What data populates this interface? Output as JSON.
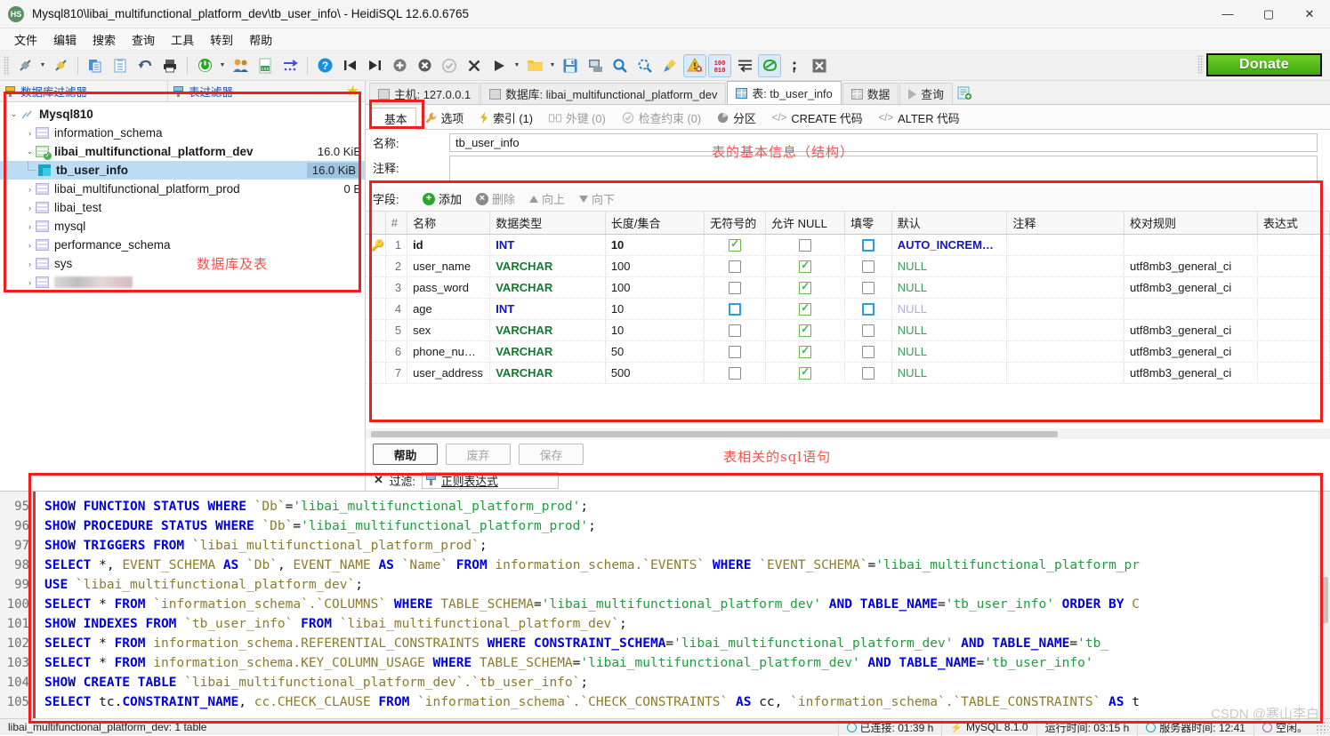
{
  "window": {
    "title": "Mysql810\\libai_multifunctional_platform_dev\\tb_user_info\\ - HeidiSQL 12.6.0.6765",
    "logo_text": "HS",
    "minimize": "—",
    "maximize": "▢",
    "close": "✕"
  },
  "menu": {
    "items": [
      "文件",
      "编辑",
      "搜索",
      "查询",
      "工具",
      "转到",
      "帮助"
    ]
  },
  "toolbar": {
    "donate_label": "Donate",
    "icons": [
      "connect-icon",
      "connect-dropdown",
      "disconnect-icon",
      "copy-icon",
      "paste-icon",
      "undo-icon",
      "print-icon",
      "refresh-icon",
      "refresh-dropdown",
      "users-icon",
      "csv-import-icon",
      "bulk-table-editor-icon",
      "help-icon",
      "first-icon",
      "last-icon",
      "add-icon",
      "remove-icon",
      "commit-icon",
      "rollback-icon",
      "run-icon",
      "run-dropdown",
      "open-icon",
      "open-dropdown",
      "save-icon",
      "save-as-icon",
      "find-icon",
      "find-replace-icon",
      "clean-icon",
      "error-icon",
      "binary-icon",
      "wrap-icon",
      "sql-format-icon",
      "semicolon-icon",
      "stop-icon"
    ]
  },
  "filters": {
    "database_filter": "数据库过滤器",
    "table_filter": "表过滤器",
    "star": "★"
  },
  "tree": {
    "root": {
      "label": "Mysql810",
      "expanded": true
    },
    "items": [
      {
        "label": "information_schema",
        "size": "",
        "level": 2,
        "expanded": false,
        "selected": false,
        "bold": false,
        "icon": "database-icon"
      },
      {
        "label": "libai_multifunctional_platform_dev",
        "size": "16.0 KiB",
        "level": 2,
        "expanded": true,
        "selected": false,
        "bold": true,
        "icon": "database-active-icon"
      },
      {
        "label": "tb_user_info",
        "size": "16.0 KiB",
        "level": 3,
        "expanded": null,
        "selected": true,
        "bold": true,
        "icon": "table-icon"
      },
      {
        "label": "libai_multifunctional_platform_prod",
        "size": "0 B",
        "level": 2,
        "expanded": false,
        "selected": false,
        "bold": false,
        "icon": "database-icon"
      },
      {
        "label": "libai_test",
        "size": "",
        "level": 2,
        "expanded": false,
        "selected": false,
        "bold": false,
        "icon": "database-icon"
      },
      {
        "label": "mysql",
        "size": "",
        "level": 2,
        "expanded": false,
        "selected": false,
        "bold": false,
        "icon": "database-icon"
      },
      {
        "label": "performance_schema",
        "size": "",
        "level": 2,
        "expanded": false,
        "selected": false,
        "bold": false,
        "icon": "database-icon"
      },
      {
        "label": "sys",
        "size": "",
        "level": 2,
        "expanded": false,
        "selected": false,
        "bold": false,
        "icon": "database-icon"
      },
      {
        "label": "",
        "size": "",
        "level": 2,
        "expanded": false,
        "selected": false,
        "bold": false,
        "icon": "database-icon",
        "redacted": true
      }
    ]
  },
  "main_tabs": [
    {
      "label": "主机: 127.0.0.1",
      "icon": "host-icon",
      "active": false
    },
    {
      "label": "数据库: libai_multifunctional_platform_dev",
      "icon": "database-icon",
      "active": false
    },
    {
      "label": "表: tb_user_info",
      "icon": "table-icon",
      "active": true
    },
    {
      "label": "数据",
      "icon": "data-grid-icon",
      "active": false
    },
    {
      "label": "查询",
      "icon": "query-play-icon",
      "active": false
    }
  ],
  "new_query_tab_icon": "new-query-tab-icon",
  "sub_tabs": [
    {
      "label": "基本",
      "icon": "basic-table-icon",
      "active": true
    },
    {
      "label": "选项",
      "icon": "wrench-icon",
      "active": false
    },
    {
      "label": "索引 (1)",
      "icon": "lightning-icon",
      "active": false
    },
    {
      "label": "外键 (0)",
      "icon": "foreign-key-icon",
      "active": false
    },
    {
      "label": "检查约束 (0)",
      "icon": "check-icon",
      "active": false
    },
    {
      "label": "分区",
      "icon": "partition-icon",
      "active": false
    },
    {
      "label": "CREATE 代码",
      "icon": "code-icon",
      "active": false
    },
    {
      "label": "ALTER 代码",
      "icon": "code-icon",
      "active": false
    }
  ],
  "table_info": {
    "name_label": "名称:",
    "name_value": "tb_user_info",
    "comment_label": "注释:",
    "comment_value": ""
  },
  "grid_toolbar": {
    "fields_label": "字段:",
    "add": "添加",
    "remove": "删除",
    "move_up": "向上",
    "move_down": "向下"
  },
  "columns_grid": {
    "headers": [
      "#",
      "名称",
      "数据类型",
      "长度/集合",
      "无符号的",
      "允许 NULL",
      "填零",
      "默认",
      "注释",
      "校对规则",
      "表达式"
    ],
    "rows": [
      {
        "num": "1",
        "key": true,
        "name": "id",
        "type": "INT",
        "type_kind": "int",
        "length": "10",
        "unsigned": true,
        "allow_null": false,
        "zerofill": false,
        "zerofill_hl": true,
        "default": "AUTO_INCREME…",
        "default_kind": "autoinc",
        "comment": "",
        "collation": "",
        "expression": "",
        "bold": true
      },
      {
        "num": "2",
        "key": false,
        "name": "user_name",
        "type": "VARCHAR",
        "type_kind": "text",
        "length": "100",
        "unsigned": false,
        "allow_null": true,
        "zerofill": false,
        "zerofill_hl": false,
        "default": "NULL",
        "default_kind": "null",
        "comment": "",
        "collation": "utf8mb3_general_ci",
        "expression": "",
        "bold": false
      },
      {
        "num": "3",
        "key": false,
        "name": "pass_word",
        "type": "VARCHAR",
        "type_kind": "text",
        "length": "100",
        "unsigned": false,
        "allow_null": true,
        "zerofill": false,
        "zerofill_hl": false,
        "default": "NULL",
        "default_kind": "null",
        "comment": "",
        "collation": "utf8mb3_general_ci",
        "expression": "",
        "bold": false
      },
      {
        "num": "4",
        "key": false,
        "name": "age",
        "type": "INT",
        "type_kind": "int",
        "length": "10",
        "unsigned": false,
        "unsigned_hl": true,
        "allow_null": true,
        "zerofill": false,
        "zerofill_hl": true,
        "default": "NULL",
        "default_kind": "null-faint",
        "comment": "",
        "collation": "",
        "expression": "",
        "bold": false
      },
      {
        "num": "5",
        "key": false,
        "name": "sex",
        "type": "VARCHAR",
        "type_kind": "text",
        "length": "10",
        "unsigned": false,
        "allow_null": true,
        "zerofill": false,
        "zerofill_hl": false,
        "default": "NULL",
        "default_kind": "null",
        "comment": "",
        "collation": "utf8mb3_general_ci",
        "expression": "",
        "bold": false
      },
      {
        "num": "6",
        "key": false,
        "name": "phone_numb…",
        "type": "VARCHAR",
        "type_kind": "text",
        "length": "50",
        "unsigned": false,
        "allow_null": true,
        "zerofill": false,
        "zerofill_hl": false,
        "default": "NULL",
        "default_kind": "null",
        "comment": "",
        "collation": "utf8mb3_general_ci",
        "expression": "",
        "bold": false
      },
      {
        "num": "7",
        "key": false,
        "name": "user_address",
        "type": "VARCHAR",
        "type_kind": "text",
        "length": "500",
        "unsigned": false,
        "allow_null": true,
        "zerofill": false,
        "zerofill_hl": false,
        "default": "NULL",
        "default_kind": "null",
        "comment": "",
        "collation": "utf8mb3_general_ci",
        "expression": "",
        "bold": false
      }
    ]
  },
  "action_buttons": {
    "help": "帮助",
    "discard": "废弃",
    "save": "保存"
  },
  "low_filter": {
    "close": "✕",
    "label": "过滤:",
    "regex": "正则表达式"
  },
  "sql_log": {
    "line_numbers": [
      "95",
      "96",
      "97",
      "98",
      "99",
      "100",
      "101",
      "102",
      "103",
      "104",
      "105"
    ],
    "lines": [
      [
        {
          "t": "SHOW FUNCTION STATUS WHERE ",
          "c": "kw"
        },
        {
          "t": "`Db`",
          "c": "bt"
        },
        {
          "t": "=",
          "c": "pl"
        },
        {
          "t": "'libai_multifunctional_platform_prod'",
          "c": "str"
        },
        {
          "t": ";",
          "c": "pl"
        }
      ],
      [
        {
          "t": "SHOW PROCEDURE STATUS WHERE ",
          "c": "kw"
        },
        {
          "t": "`Db`",
          "c": "bt"
        },
        {
          "t": "=",
          "c": "pl"
        },
        {
          "t": "'libai_multifunctional_platform_prod'",
          "c": "str"
        },
        {
          "t": ";",
          "c": "pl"
        }
      ],
      [
        {
          "t": "SHOW TRIGGERS FROM ",
          "c": "kw"
        },
        {
          "t": "`libai_multifunctional_platform_prod`",
          "c": "bt"
        },
        {
          "t": ";",
          "c": "pl"
        }
      ],
      [
        {
          "t": "SELECT ",
          "c": "kw"
        },
        {
          "t": "*, ",
          "c": "pl"
        },
        {
          "t": "EVENT_SCHEMA ",
          "c": "bt"
        },
        {
          "t": "AS ",
          "c": "kw"
        },
        {
          "t": "`Db`",
          "c": "bt"
        },
        {
          "t": ", ",
          "c": "pl"
        },
        {
          "t": "EVENT_NAME ",
          "c": "bt"
        },
        {
          "t": "AS ",
          "c": "kw"
        },
        {
          "t": "`Name` ",
          "c": "bt"
        },
        {
          "t": "FROM ",
          "c": "kw"
        },
        {
          "t": "information_schema.`EVENTS` ",
          "c": "bt"
        },
        {
          "t": "WHERE ",
          "c": "kw"
        },
        {
          "t": "`EVENT_SCHEMA`",
          "c": "bt"
        },
        {
          "t": "=",
          "c": "pl"
        },
        {
          "t": "'libai_multifunctional_platform_pr",
          "c": "str"
        }
      ],
      [
        {
          "t": "USE ",
          "c": "kw"
        },
        {
          "t": "`libai_multifunctional_platform_dev`",
          "c": "bt"
        },
        {
          "t": ";",
          "c": "pl"
        }
      ],
      [
        {
          "t": "SELECT ",
          "c": "kw"
        },
        {
          "t": "* ",
          "c": "pl"
        },
        {
          "t": "FROM ",
          "c": "kw"
        },
        {
          "t": "`information_schema`.`COLUMNS` ",
          "c": "bt"
        },
        {
          "t": "WHERE ",
          "c": "kw"
        },
        {
          "t": "TABLE_SCHEMA",
          "c": "bt"
        },
        {
          "t": "=",
          "c": "pl"
        },
        {
          "t": "'libai_multifunctional_platform_dev' ",
          "c": "str"
        },
        {
          "t": "AND TABLE_NAME",
          "c": "kw"
        },
        {
          "t": "=",
          "c": "pl"
        },
        {
          "t": "'tb_user_info' ",
          "c": "str"
        },
        {
          "t": "ORDER BY ",
          "c": "kw"
        },
        {
          "t": "C",
          "c": "bt"
        }
      ],
      [
        {
          "t": "SHOW INDEXES FROM ",
          "c": "kw"
        },
        {
          "t": "`tb_user_info` ",
          "c": "bt"
        },
        {
          "t": "FROM ",
          "c": "kw"
        },
        {
          "t": "`libai_multifunctional_platform_dev`",
          "c": "bt"
        },
        {
          "t": ";",
          "c": "pl"
        }
      ],
      [
        {
          "t": "SELECT ",
          "c": "kw"
        },
        {
          "t": "* ",
          "c": "pl"
        },
        {
          "t": "FROM ",
          "c": "kw"
        },
        {
          "t": "information_schema.REFERENTIAL_CONSTRAINTS ",
          "c": "bt"
        },
        {
          "t": "WHERE   CONSTRAINT_SCHEMA",
          "c": "kw"
        },
        {
          "t": "=",
          "c": "pl"
        },
        {
          "t": "'libai_multifunctional_platform_dev'   ",
          "c": "str"
        },
        {
          "t": "AND TABLE_NAME",
          "c": "kw"
        },
        {
          "t": "=",
          "c": "pl"
        },
        {
          "t": "'tb_",
          "c": "str"
        }
      ],
      [
        {
          "t": "SELECT ",
          "c": "kw"
        },
        {
          "t": "* ",
          "c": "pl"
        },
        {
          "t": "FROM ",
          "c": "kw"
        },
        {
          "t": "information_schema.KEY_COLUMN_USAGE ",
          "c": "bt"
        },
        {
          "t": "WHERE   ",
          "c": "kw"
        },
        {
          "t": "TABLE_SCHEMA",
          "c": "bt"
        },
        {
          "t": "=",
          "c": "pl"
        },
        {
          "t": "'libai_multifunctional_platform_dev'   ",
          "c": "str"
        },
        {
          "t": "AND TABLE_NAME",
          "c": "kw"
        },
        {
          "t": "=",
          "c": "pl"
        },
        {
          "t": "'tb_user_info'",
          "c": "str"
        }
      ],
      [
        {
          "t": "SHOW CREATE TABLE ",
          "c": "kw"
        },
        {
          "t": "`libai_multifunctional_platform_dev`.`tb_user_info`",
          "c": "bt"
        },
        {
          "t": ";",
          "c": "pl"
        }
      ],
      [
        {
          "t": "SELECT ",
          "c": "kw"
        },
        {
          "t": "tc.",
          "c": "pl"
        },
        {
          "t": "CONSTRAINT_NAME",
          "c": "kw"
        },
        {
          "t": ", ",
          "c": "pl"
        },
        {
          "t": "cc.CHECK_CLAUSE ",
          "c": "bt"
        },
        {
          "t": "FROM ",
          "c": "kw"
        },
        {
          "t": "`information_schema`.`CHECK_CONSTRAINTS` ",
          "c": "bt"
        },
        {
          "t": "AS ",
          "c": "kw"
        },
        {
          "t": "cc, ",
          "c": "pl"
        },
        {
          "t": "`information_schema`.`TABLE_CONSTRAINTS` ",
          "c": "bt"
        },
        {
          "t": "AS ",
          "c": "kw"
        },
        {
          "t": "t",
          "c": "pl"
        }
      ]
    ]
  },
  "status_bar": {
    "left": "libai_multifunctional_platform_dev: 1 table",
    "segments": [
      {
        "label": "已连接: 01:39 h",
        "icon": "clock-icon"
      },
      {
        "label": "MySQL 8.1.0",
        "icon": "plug-icon"
      },
      {
        "label": "运行时间: 03:15 h",
        "icon": ""
      },
      {
        "label": "服务器时间: 12:41",
        "icon": "clock-icon"
      },
      {
        "label": "空闲。",
        "icon": "idle-icon"
      }
    ]
  },
  "annotations": [
    {
      "text": "数据库及表",
      "name": "annotation-databases-and-tables"
    },
    {
      "text": "表的基本信息（结构）",
      "name": "annotation-table-basic-info"
    },
    {
      "text": "表相关的sql语句",
      "name": "annotation-related-sql"
    }
  ],
  "watermark": "CSDN @寒山李白"
}
